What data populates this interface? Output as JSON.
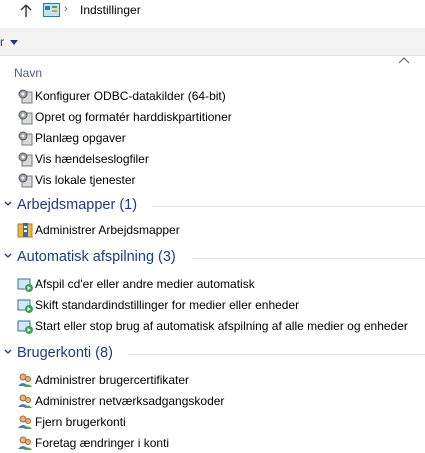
{
  "address": {
    "breadcrumb": "Indstillinger"
  },
  "toolbar": {
    "label": "r"
  },
  "columns": {
    "name": "Navn"
  },
  "groups": [
    {
      "title": "Arbejdsmapper (1)"
    },
    {
      "title": "Automatisk afspilning (3)"
    },
    {
      "title": "Brugerkonti (8)"
    }
  ],
  "admin_items": [
    "Konfigurer ODBC-datakilder (64-bit)",
    "Opret og formatér harddiskpartitioner",
    "Planlæg opgaver",
    "Vis hændelseslogfiler",
    "Vis lokale tjenester"
  ],
  "workfolders_items": [
    "Administrer Arbejdsmapper"
  ],
  "autoplay_items": [
    "Afspil cd'er eller andre medier automatisk",
    "Skift standardindstillinger for medier eller enheder",
    "Start eller stop brug af automatisk afspilning af alle medier og enheder"
  ],
  "accounts_items": [
    "Administrer brugercertifikater",
    "Administrer netværksadgangskoder",
    "Fjern brugerkonti",
    "Foretag ændringer i konti"
  ],
  "colors": {
    "accent": "#1e3a8a",
    "divider": "#e2e6ee"
  }
}
